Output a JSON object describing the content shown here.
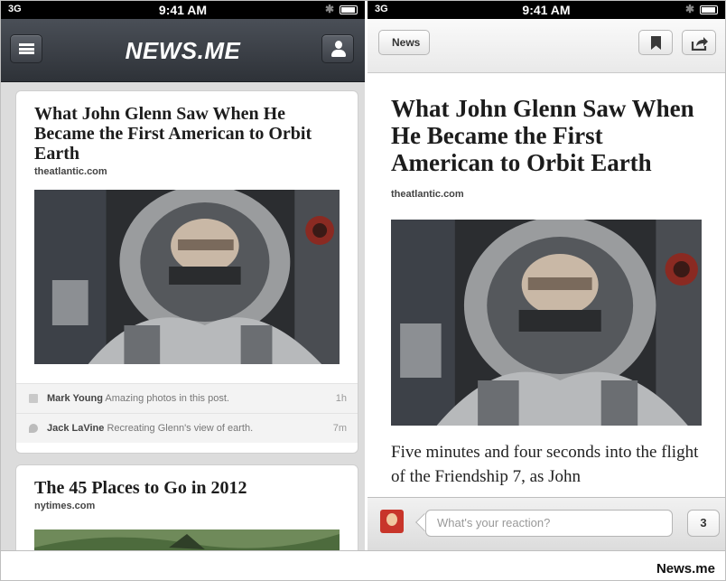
{
  "status_bar": {
    "signal": "3G",
    "time": "9:41 AM"
  },
  "feed_screen": {
    "app_title": "NEWS.ME",
    "stories": [
      {
        "headline": "What John Glenn Saw When He Became the First American to Orbit Earth",
        "source": "theatlantic.com",
        "comments": [
          {
            "name": "Mark Young",
            "text": "Amazing photos in this post.",
            "time": "1h",
            "icon": "facebook-icon"
          },
          {
            "name": "Jack LaVine",
            "text": "Recreating Glenn's view of earth.",
            "time": "7m",
            "icon": "twitter-icon"
          }
        ]
      },
      {
        "headline": "The 45 Places to Go in 2012",
        "source": "nytimes.com"
      }
    ]
  },
  "article_screen": {
    "back_label": "News",
    "headline": "What John Glenn Saw When He Became the First American to Orbit Earth",
    "source": "theatlantic.com",
    "body": "Five minutes and four seconds into the flight of the Friendship 7, as John",
    "reaction_placeholder": "What's your reaction?",
    "reaction_count": "3"
  },
  "caption": "News.me",
  "colors": {
    "nav_dark": "#3a3e45",
    "card_bg": "#ffffff",
    "feed_bg": "#dcdcdc"
  }
}
